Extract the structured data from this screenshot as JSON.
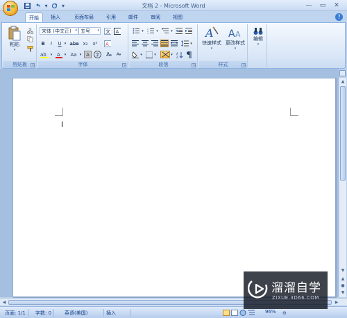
{
  "window": {
    "title": "文档 2 - Microsoft Word"
  },
  "quick_access": {
    "icons": [
      "save-icon",
      "undo-icon",
      "redo-icon",
      "customize-icon"
    ]
  },
  "tabs": [
    {
      "label": "开始",
      "active": true
    },
    {
      "label": "插入"
    },
    {
      "label": "页面布局"
    },
    {
      "label": "引用"
    },
    {
      "label": "邮件"
    },
    {
      "label": "审阅"
    },
    {
      "label": "视图"
    }
  ],
  "ribbon": {
    "clipboard": {
      "label": "剪贴板",
      "paste": "粘贴"
    },
    "font": {
      "label": "字体",
      "font_name": "宋体 (中文正)",
      "font_size": "五号",
      "bold": "B",
      "italic": "I",
      "underline": "U",
      "strike": "abe",
      "sub": "x₂",
      "sup": "x²",
      "change_case": "Aa",
      "char_border": "A",
      "enclosed": "字",
      "grow": "A",
      "shrink": "A"
    },
    "paragraph": {
      "label": "段落"
    },
    "styles": {
      "label": "样式",
      "quick_styles": "快速样式",
      "change_styles": "更改样式"
    },
    "editing": {
      "label": "编辑"
    }
  },
  "status": {
    "page": "页面: 1/1",
    "words": "字数: 0",
    "language": "英语(美国)",
    "mode": "插入",
    "zoom": "96%"
  },
  "watermark": {
    "title": "溜溜自学",
    "subtitle": "ZIXUE.3D66.COM"
  },
  "colors": {
    "accent": "#15428b",
    "ribbon": "#dbe7f6",
    "highlight": "#fbb94a"
  }
}
